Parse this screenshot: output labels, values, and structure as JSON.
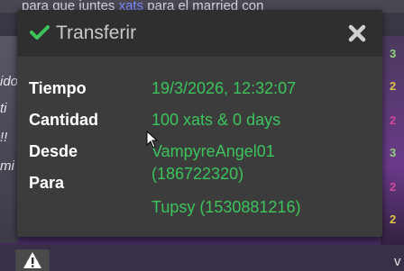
{
  "background": {
    "chat_line": "para que juntes xats para el married con",
    "chat_highlight": "xats",
    "left_fragments": [
      "ido",
      "ti",
      "!!",
      "mi"
    ],
    "right_fragments": [
      "3",
      "2",
      "2",
      "3",
      "2",
      "2"
    ],
    "bottom_letter": "v"
  },
  "dialog": {
    "title": "Transferir",
    "fields": [
      {
        "label": "Tiempo",
        "value": "19/3/2026, 12:32:07"
      },
      {
        "label": "Cantidad",
        "value": "100 xats & 0 days"
      },
      {
        "label": "Desde",
        "value": "VampyreAngel01"
      },
      {
        "label": "Para",
        "value": "(186722320)"
      }
    ],
    "extra_value": "Tupsy (1530881216)"
  },
  "colors": {
    "accent_green": "#3cc45c",
    "dialog_bg": "#3c3c3c",
    "titlebar_bg": "#2f2f2f"
  },
  "icons": {
    "title": "check-icon",
    "close": "close-icon",
    "warning": "warning-icon"
  }
}
